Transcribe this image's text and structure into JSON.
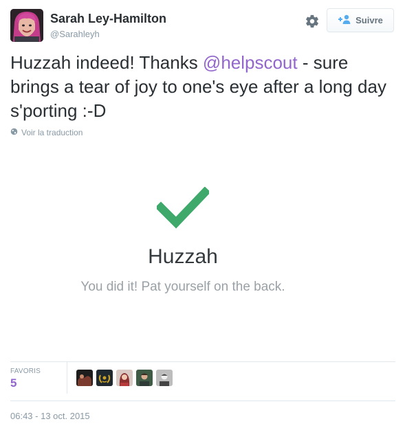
{
  "tweet": {
    "author_name": "Sarah Ley-Hamilton",
    "author_handle": "@Sarahleyh",
    "follow_label": "Suivre",
    "text_before": "Huzzah indeed! Thanks ",
    "mention": "@helpscout",
    "text_after": " - sure brings a tear of joy to one's eye after a long day s'porting :-D",
    "translate_label": "Voir la traduction",
    "timestamp": "06:43 - 13 oct. 2015"
  },
  "card": {
    "title": "Huzzah",
    "subtitle": "You did it! Pat yourself on the back.",
    "check_color": "#3ea96b"
  },
  "favorites": {
    "label": "FAVORIS",
    "count": "5"
  },
  "icons": {
    "gear": "gear-icon",
    "follow": "add-user-icon",
    "globe": "globe-icon",
    "check": "checkmark-icon"
  },
  "colors": {
    "mention": "#9266cc",
    "muted": "#8899a6",
    "follow_icon": "#55acee"
  }
}
